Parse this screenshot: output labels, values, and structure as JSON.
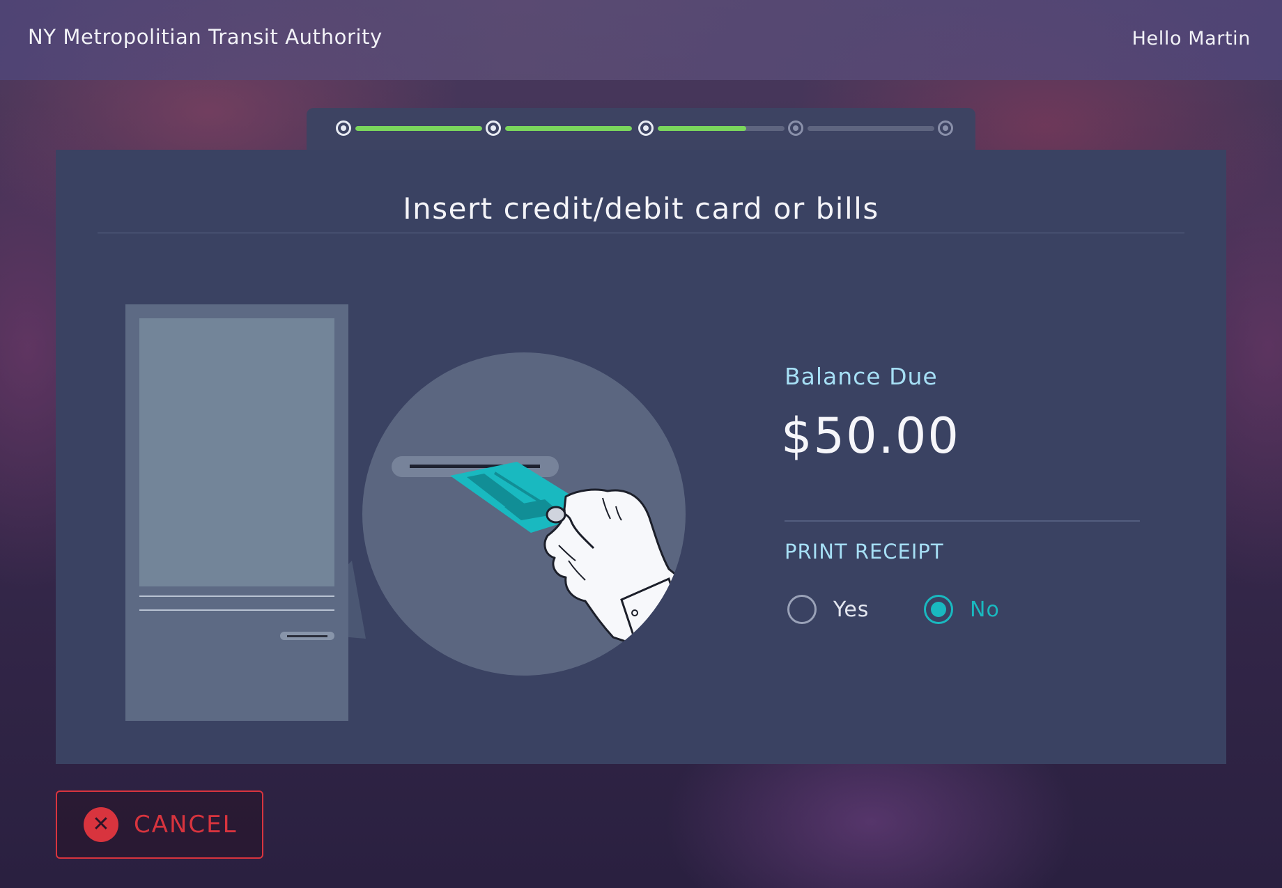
{
  "header": {
    "agency_name": "NY Metropolitian Transit Authority",
    "greeting": "Hello Martin"
  },
  "stepper": {
    "total_steps": 5,
    "completed_steps": 3,
    "current_progress": 0.7,
    "accent_color": "#7bd65c"
  },
  "main": {
    "title": "Insert credit/debit card or bills",
    "illustration": {
      "icons": [
        "kiosk-machine-icon",
        "card-slot-icon",
        "credit-card-icon",
        "hand-icon"
      ],
      "card_color": "#19b9c0"
    },
    "balance": {
      "label": "Balance Due",
      "amount": "$50.00"
    },
    "receipt": {
      "label": "PRINT RECEIPT",
      "options": [
        {
          "label": "Yes",
          "selected": false
        },
        {
          "label": "No",
          "selected": true
        }
      ],
      "selected_color": "#19b9c0"
    }
  },
  "footer": {
    "cancel_label": "CANCEL",
    "cancel_icon": "close-icon",
    "cancel_color": "#d8343e"
  }
}
